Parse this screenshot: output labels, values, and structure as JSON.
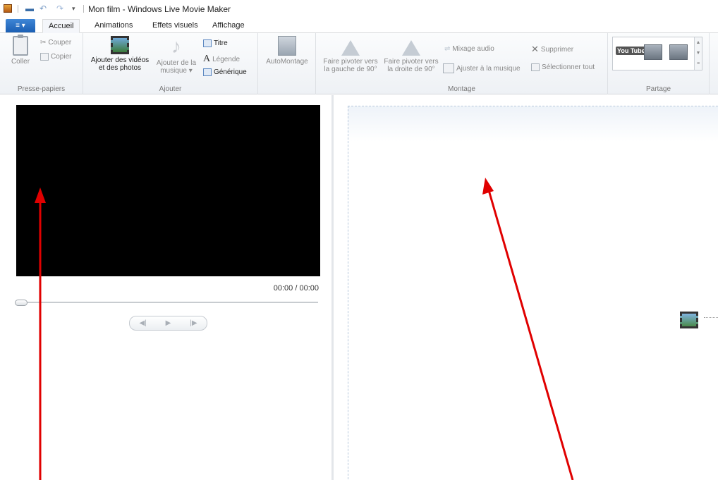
{
  "window": {
    "title": "Mon film - Windows Live Movie Maker",
    "quick_access": [
      "save-icon",
      "undo-icon",
      "redo-icon",
      "customize-icon"
    ]
  },
  "tabs": {
    "file_label": "≡ ▾",
    "items": [
      "Accueil",
      "Animations",
      "Effets visuels",
      "Affichage"
    ],
    "active": "Accueil"
  },
  "ribbon": {
    "clipboard": {
      "label": "Presse-papiers",
      "paste": "Coller",
      "cut": "Couper",
      "copy": "Copier"
    },
    "add": {
      "label": "Ajouter",
      "add_videos_line1": "Ajouter des vidéos",
      "add_videos_line2": "et des photos",
      "add_music_line1": "Ajouter de la",
      "add_music_line2": "musique ▾",
      "title": "Titre",
      "caption": "Légende",
      "credits": "Générique"
    },
    "automovie": "AutoMontage",
    "editing": {
      "label": "Montage",
      "rotate_left_line1": "Faire pivoter vers",
      "rotate_left_line2": "la gauche de 90°",
      "rotate_right_line1": "Faire pivoter vers",
      "rotate_right_line2": "la droite de 90°",
      "audio_mix": "Mixage audio",
      "fit_music": "Ajuster à la musique",
      "delete": "Supprimer",
      "select_all": "Sélectionner tout"
    },
    "share": {
      "label": "Partage",
      "youtube": "You Tube"
    }
  },
  "preview": {
    "timecode": "00:00 / 00:00",
    "controls": [
      "◀|",
      "▶",
      "|▶"
    ]
  },
  "colors": {
    "annotation_arrow": "#e00000",
    "accent": "#1b5fb3"
  }
}
